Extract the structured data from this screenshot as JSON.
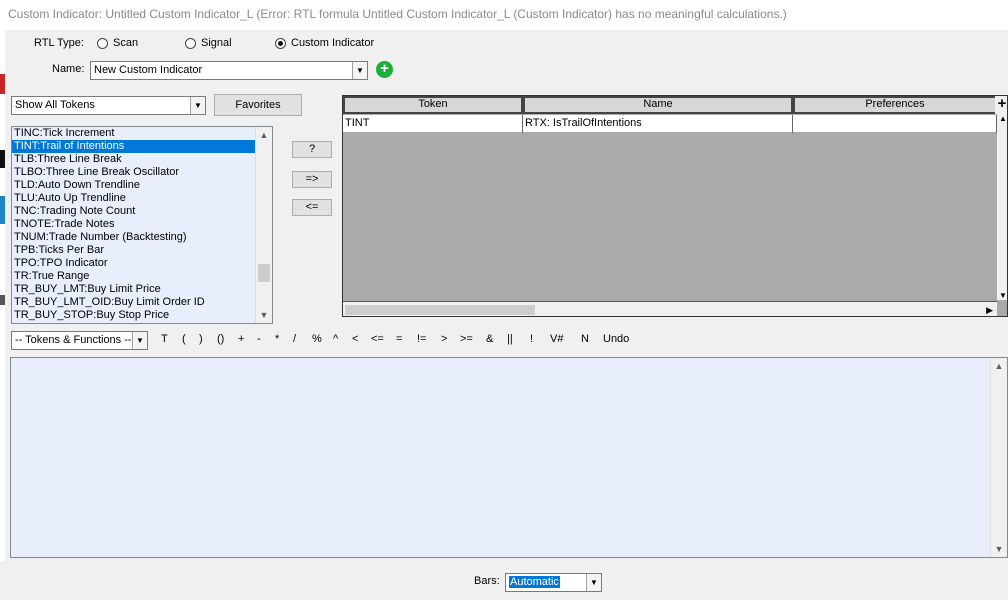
{
  "window": {
    "title": "Custom Indicator: Untitled Custom Indicator_L (Error: RTL formula Untitled Custom Indicator_L (Custom Indicator) has no meaningful calculations.)"
  },
  "rtl_type": {
    "label": "RTL Type:",
    "options": [
      {
        "label": "Scan",
        "selected": false
      },
      {
        "label": "Signal",
        "selected": false
      },
      {
        "label": "Custom Indicator",
        "selected": true
      }
    ]
  },
  "name_field": {
    "label": "Name:",
    "value": "New Custom Indicator"
  },
  "token_filter": {
    "value": "Show All Tokens",
    "favorites_label": "Favorites"
  },
  "token_list": {
    "items": [
      "TINC:Tick Increment",
      "TINT:Trail of Intentions",
      "TLB:Three Line Break",
      "TLBO:Three Line Break Oscillator",
      "TLD:Auto Down Trendline",
      "TLU:Auto Up Trendline",
      "TNC:Trading Note Count",
      "TNOTE:Trade Notes",
      "TNUM:Trade Number (Backtesting)",
      "TPB:Ticks Per Bar",
      "TPO:TPO Indicator",
      "TR:True Range",
      "TR_BUY_LMT:Buy Limit Price",
      "TR_BUY_LMT_OID:Buy Limit Order ID",
      "TR_BUY_STOP:Buy Stop Price"
    ],
    "selected_index": 1
  },
  "middle_buttons": {
    "help": "?",
    "add": "=>",
    "remove": "<="
  },
  "grid": {
    "columns": [
      "Token",
      "Name",
      "Preferences"
    ],
    "add_column": "+",
    "rows": [
      {
        "token": "TINT",
        "name": "RTX: IsTrailOfIntentions",
        "preferences": ""
      }
    ]
  },
  "operators": {
    "dropdown": "-- Tokens & Functions --",
    "items": [
      "T",
      "(",
      ")",
      "()",
      "+",
      "-",
      "*",
      "/",
      "%",
      "^",
      "<",
      "<=",
      "=",
      "!=",
      ">",
      ">=",
      "&",
      "||",
      "!",
      "V#",
      "N",
      "Undo"
    ]
  },
  "bars": {
    "label": "Bars:",
    "value": "Automatic"
  },
  "colors": {
    "selection": "#0078d7",
    "list_bg": "#e8eefc",
    "add_green": "#1fae3c",
    "grid_bg": "#aaaaaa"
  }
}
